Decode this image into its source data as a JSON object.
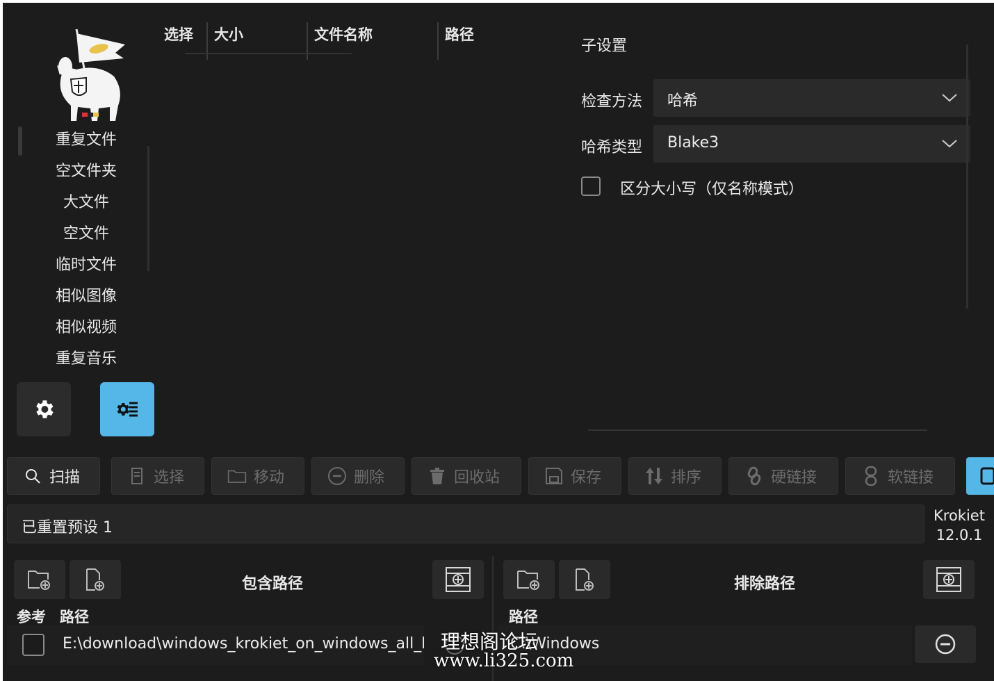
{
  "sidebar": {
    "items": [
      {
        "label": "重复文件"
      },
      {
        "label": "空文件夹"
      },
      {
        "label": "大文件"
      },
      {
        "label": "空文件"
      },
      {
        "label": "临时文件"
      },
      {
        "label": "相似图像"
      },
      {
        "label": "相似视频"
      },
      {
        "label": "重复音乐"
      }
    ]
  },
  "table": {
    "columns": [
      "选择",
      "大小",
      "文件名称",
      "路径"
    ]
  },
  "sub_settings": {
    "title": "子设置",
    "check_method_label": "检查方法",
    "check_method_value": "哈希",
    "hash_type_label": "哈希类型",
    "hash_type_value": "Blake3",
    "case_sensitive_label": "区分大小写（仅名称模式）",
    "case_sensitive_checked": false
  },
  "toolbar": {
    "buttons": [
      {
        "label": "扫描",
        "icon": "search-icon",
        "enabled": true
      },
      {
        "label": "选择",
        "icon": "select-icon",
        "enabled": false
      },
      {
        "label": "移动",
        "icon": "folder-icon",
        "enabled": false
      },
      {
        "label": "删除",
        "icon": "minus-circle-icon",
        "enabled": false
      },
      {
        "label": "回收站",
        "icon": "trash-icon",
        "enabled": false
      },
      {
        "label": "保存",
        "icon": "save-icon",
        "enabled": false
      },
      {
        "label": "排序",
        "icon": "sort-icon",
        "enabled": false
      },
      {
        "label": "硬链接",
        "icon": "link-icon",
        "enabled": false
      },
      {
        "label": "软链接",
        "icon": "soft-link-icon",
        "enabled": false
      }
    ]
  },
  "status": {
    "text": "已重置预设 1",
    "app_name": "Krokiet",
    "version": "12.0.1"
  },
  "included": {
    "title": "包含路径",
    "col_ref": "参考",
    "col_path": "路径",
    "rows": [
      {
        "path": "E:\\download\\windows_krokiet_on_windows_all_ba",
        "reference": false
      }
    ]
  },
  "excluded": {
    "title": "排除路径",
    "col_path": "路径",
    "rows": [
      {
        "path": "C:\\Windows"
      }
    ]
  },
  "watermark": {
    "line1": "理想阁论坛",
    "line2": "www.li325.com"
  },
  "colors": {
    "background": "#1c1c1c",
    "accent": "#55b6e8",
    "button": "#2a2a2a"
  }
}
